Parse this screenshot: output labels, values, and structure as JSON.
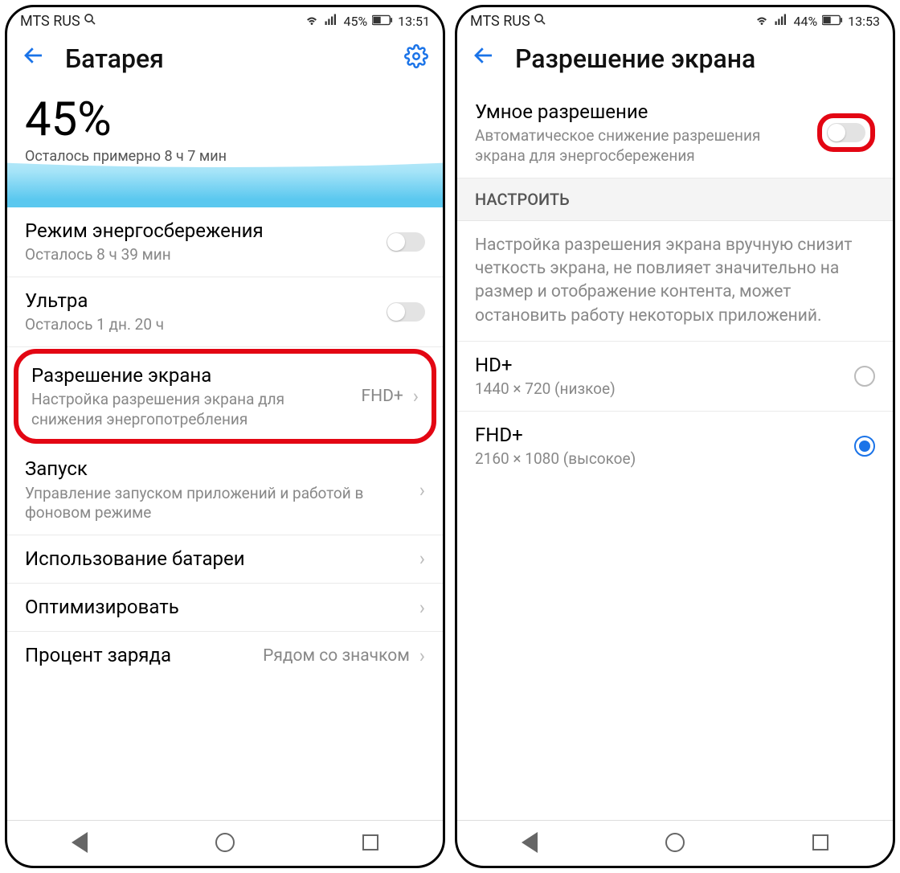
{
  "left": {
    "status": {
      "carrier": "MTS RUS",
      "battery": "45%",
      "time": "13:51"
    },
    "header": {
      "title": "Батарея"
    },
    "hero": {
      "percent": "45%",
      "remaining": "Осталось примерно 8 ч 7 мин"
    },
    "items": {
      "power_save": {
        "title": "Режим энергосбережения",
        "sub": "Осталось 8 ч 39 мин"
      },
      "ultra": {
        "title": "Ультра",
        "sub": "Осталось 1 дн. 20 ч"
      },
      "resolution": {
        "title": "Разрешение экрана",
        "sub": "Настройка разрешения экрана для снижения энергопотребления",
        "value": "FHD+"
      },
      "launch": {
        "title": "Запуск",
        "sub": "Управление запуском приложений и работой в фоновом режиме"
      },
      "usage": {
        "title": "Использование батареи"
      },
      "optimize": {
        "title": "Оптимизировать"
      },
      "percent_row": {
        "title": "Процент заряда",
        "value": "Рядом со значком"
      }
    }
  },
  "right": {
    "status": {
      "carrier": "MTS RUS",
      "battery": "44%",
      "time": "13:53"
    },
    "header": {
      "title": "Разрешение экрана"
    },
    "smart": {
      "title": "Умное разрешение",
      "sub": "Автоматическое снижение разрешения экрана для энергосбережения"
    },
    "section": "НАСТРОИТЬ",
    "desc": "Настройка разрешения экрана вручную снизит четкость экрана, не повлияет значительно на размер и отображение контента, может остановить работу некоторых приложений.",
    "options": {
      "hd": {
        "title": "HD+",
        "sub": "1440 × 720 (низкое)"
      },
      "fhd": {
        "title": "FHD+",
        "sub": "2160 × 1080 (высокое)"
      }
    }
  }
}
